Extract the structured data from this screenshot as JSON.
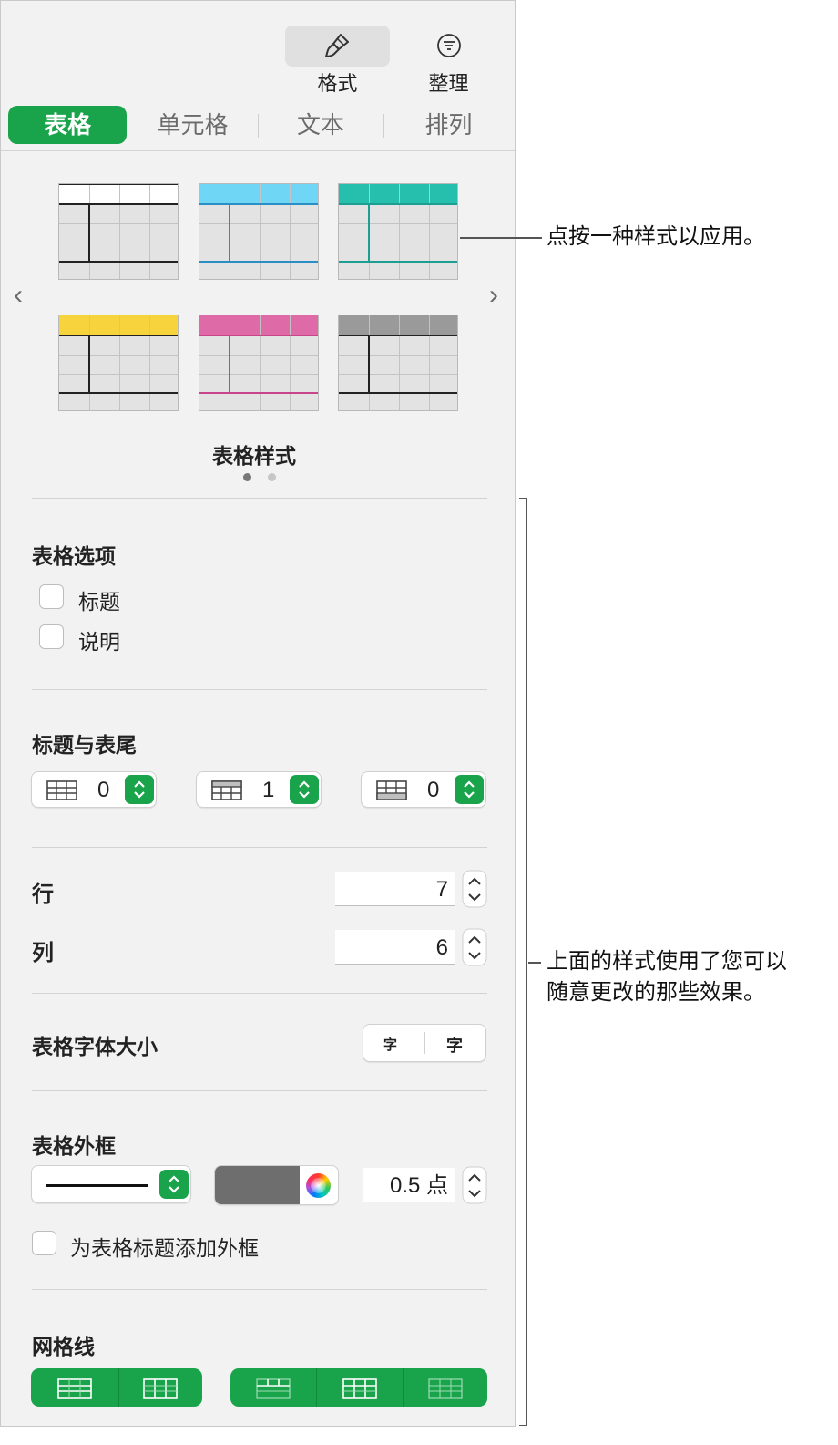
{
  "toolbar": {
    "format_label": "格式",
    "organize_label": "整理"
  },
  "tabs": [
    {
      "label": "表格",
      "active": true
    },
    {
      "label": "单元格",
      "active": false
    },
    {
      "label": "文本",
      "active": false
    },
    {
      "label": "排列",
      "active": false
    }
  ],
  "styles": {
    "title": "表格样式",
    "page_count": 2,
    "current_page": 1,
    "thumbnails": [
      {
        "header_color": "#ffffff",
        "accent": "#222222"
      },
      {
        "header_color": "#6fd6f5",
        "accent": "#2a8fc4"
      },
      {
        "header_color": "#26bfae",
        "accent": "#1d9e92"
      },
      {
        "header_color": "#f7d33e",
        "accent": "#222222"
      },
      {
        "header_color": "#df6aa8",
        "accent": "#c9458b"
      },
      {
        "header_color": "#9a9a9a",
        "accent": "#222222"
      }
    ]
  },
  "table_options": {
    "title": "表格选项",
    "title_checkbox": "标题",
    "caption_checkbox": "说明"
  },
  "headers_footers": {
    "title": "标题与表尾",
    "header_rows": "0",
    "header_columns": "1",
    "footer_rows": "0"
  },
  "rows_label": "行",
  "rows_value": "7",
  "columns_label": "列",
  "columns_value": "6",
  "font_size": {
    "title": "表格字体大小",
    "smaller": "字",
    "larger": "字"
  },
  "outline": {
    "title": "表格外框",
    "color": "#6e6e6e",
    "width": "0.5 点",
    "title_outline_label": "为表格标题添加外框"
  },
  "gridlines": {
    "title": "网格线"
  },
  "callouts": {
    "apply_style": "点按一种样式以应用。",
    "effects_line1": "上面的样式使用了您可以",
    "effects_line2": "随意更改的那些效果。"
  },
  "colors": {
    "accent_green": "#19a34a",
    "panel_bg": "#f2f2f2"
  }
}
